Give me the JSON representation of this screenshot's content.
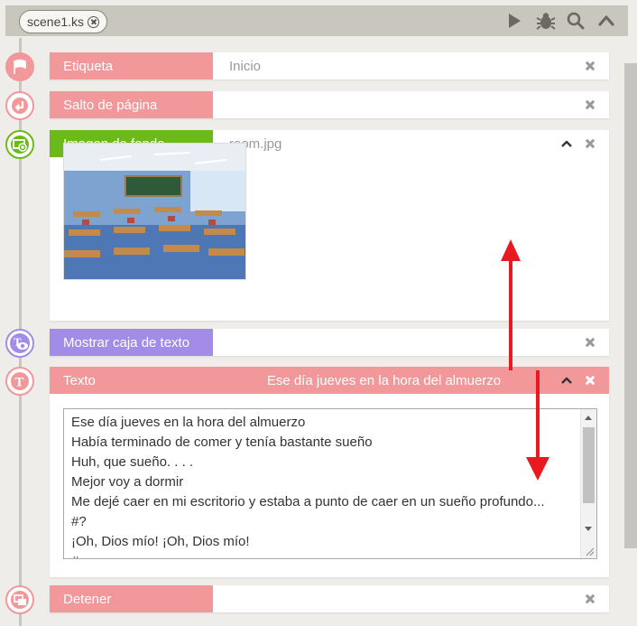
{
  "tab": {
    "name": "scene1.ks"
  },
  "toolbar": {
    "icons": [
      "play-icon",
      "bug-icon",
      "search-icon",
      "chevron-up-icon"
    ]
  },
  "cards": {
    "etiqueta": {
      "label": "Etiqueta",
      "value": "Inicio"
    },
    "salto": {
      "label": "Salto de página",
      "value": ""
    },
    "fondo": {
      "label": "Imagen de fondo",
      "value": "room.jpg"
    },
    "mostrar": {
      "label": "Mostrar caja de texto",
      "value": ""
    },
    "texto": {
      "label": "Texto",
      "value": "Ese día jueves en la hora del almuerzo",
      "lines": [
        "Ese día jueves en la hora del almuerzo",
        "Había terminado de comer y tenía bastante sueño",
        "Huh, que sueño. . . .",
        "Mejor voy a dormir",
        "Me dejé caer en mi escritorio y estaba a punto de caer en un sueño profundo...",
        "#?",
        "¡Oh, Dios mío! ¡Oh, Dios mío!",
        "#"
      ]
    },
    "detener": {
      "label": "Detener",
      "value": ""
    }
  },
  "colors": {
    "pink": "#f2979a",
    "green": "#6cba19",
    "purple": "#a28ce8",
    "arrow": "#e8191f"
  }
}
